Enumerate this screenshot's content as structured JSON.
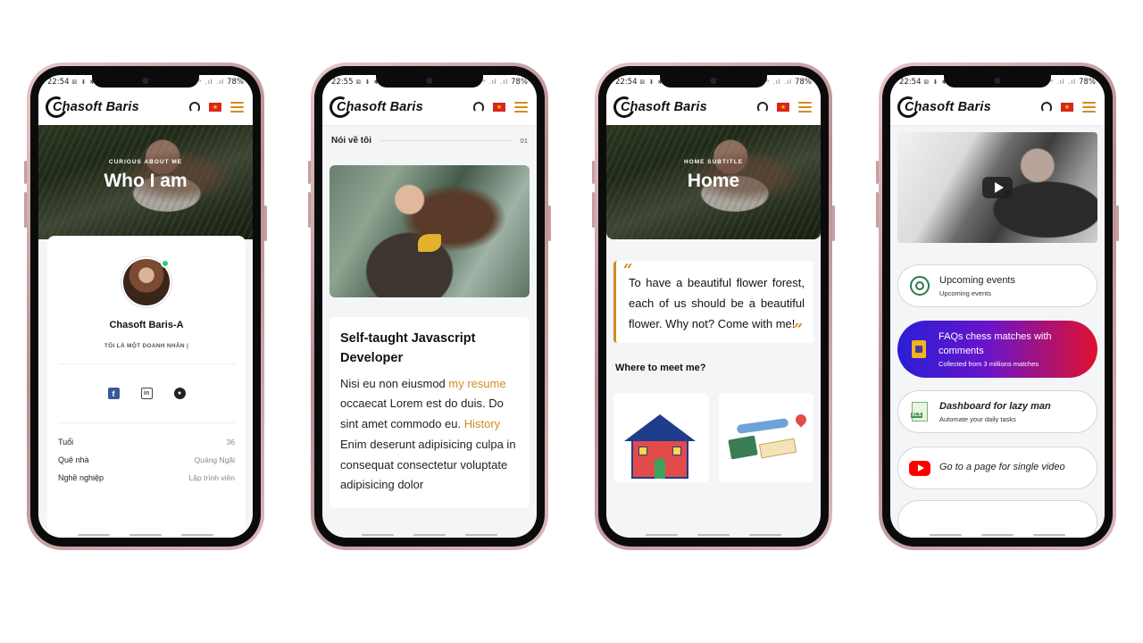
{
  "status": [
    {
      "time": "22:54",
      "icons": "⊠ ⬇ ✱ ☺ ◉",
      "signal": "⎍ᴺ ⁴ᴳ .ıl .ıl",
      "battery": "78%"
    },
    {
      "time": "22:55",
      "icons": "⊠ ⬇ ✱ ☺ ◉",
      "signal": "⎍ᴺ ⁴ᴳ .ıl .ıl",
      "battery": "78%"
    },
    {
      "time": "22:54",
      "icons": "⊠ ⬇ ✱ ☺ ◉",
      "signal": "⎍ᴺ ⁴ᴳ .ıl .ıl",
      "battery": "78%"
    },
    {
      "time": "22:54",
      "icons": "⊠ ⬇ ✱ ☺ ◉",
      "signal": "⎍ᴺ ⁴ᴳ .ıl .ıl",
      "battery": "78%"
    }
  ],
  "app": {
    "logo_text": "Chasoft Baris",
    "flag_star": "★",
    "icons": {
      "support": "headset-icon",
      "language": "vietnam-flag-icon",
      "menu": "hamburger-menu-icon"
    },
    "accent_color": "#d48a1f"
  },
  "phone1": {
    "hero_subtitle": "CURIOUS ABOUT ME",
    "hero_title": "Who I am",
    "name": "Chasoft Baris-A",
    "tagline": "TÔI LÀ MỘT DOANH NHÂN |",
    "socials": [
      {
        "icon": "facebook-icon",
        "glyph": "f"
      },
      {
        "icon": "linkedin-icon",
        "glyph": "in"
      },
      {
        "icon": "github-icon",
        "glyph": "●"
      }
    ],
    "info": [
      {
        "label": "Tuổi",
        "value": "36"
      },
      {
        "label": "Quê nhà",
        "value": "Quảng Ngãi"
      },
      {
        "label": "Nghề nghiệp",
        "value": "Lập trình viên"
      }
    ]
  },
  "phone2": {
    "section_title": "Nói về tôi",
    "section_number": "01",
    "card_title": "Self-taught Javascript Developer",
    "body_1": "Nisi eu non eiusmod ",
    "link_1": "my resume",
    "body_2": " occaecat Lorem est do duis. Do sint amet commodo eu. ",
    "link_2": "History",
    "body_3": " Enim deserunt adipisicing culpa in consequat consectetur voluptate adipisicing dolor"
  },
  "phone3": {
    "hero_subtitle": "HOME SUBTITLE",
    "hero_title": "Home",
    "quote": "To have a beautiful flower forest, each of us should be a beautiful flower. Why not? Come with me!",
    "quote_open": "“",
    "quote_close": "”",
    "meet_title": "Where to meet me?",
    "meet_cards": [
      {
        "icon": "house-illustration"
      },
      {
        "icon": "travel-illustration"
      }
    ]
  },
  "phone4": {
    "video": {
      "icon": "play-button-icon"
    },
    "items": [
      {
        "title": "Upcoming events",
        "subtitle": "Upcoming events",
        "icon": "target-ring-icon"
      },
      {
        "title": "FAQs chess matches with comments",
        "subtitle": "Collected from 3 millions matches",
        "icon": "sim-card-icon",
        "gradient": [
          "#2a1ed6",
          "#e0112f"
        ]
      },
      {
        "title": "Dashboard for lazy man",
        "subtitle": "Automate your daily tasks",
        "icon": "xls-file-icon",
        "badge": "XLS"
      },
      {
        "title": "Go to a page for single video",
        "subtitle": "",
        "icon": "youtube-icon"
      }
    ]
  }
}
